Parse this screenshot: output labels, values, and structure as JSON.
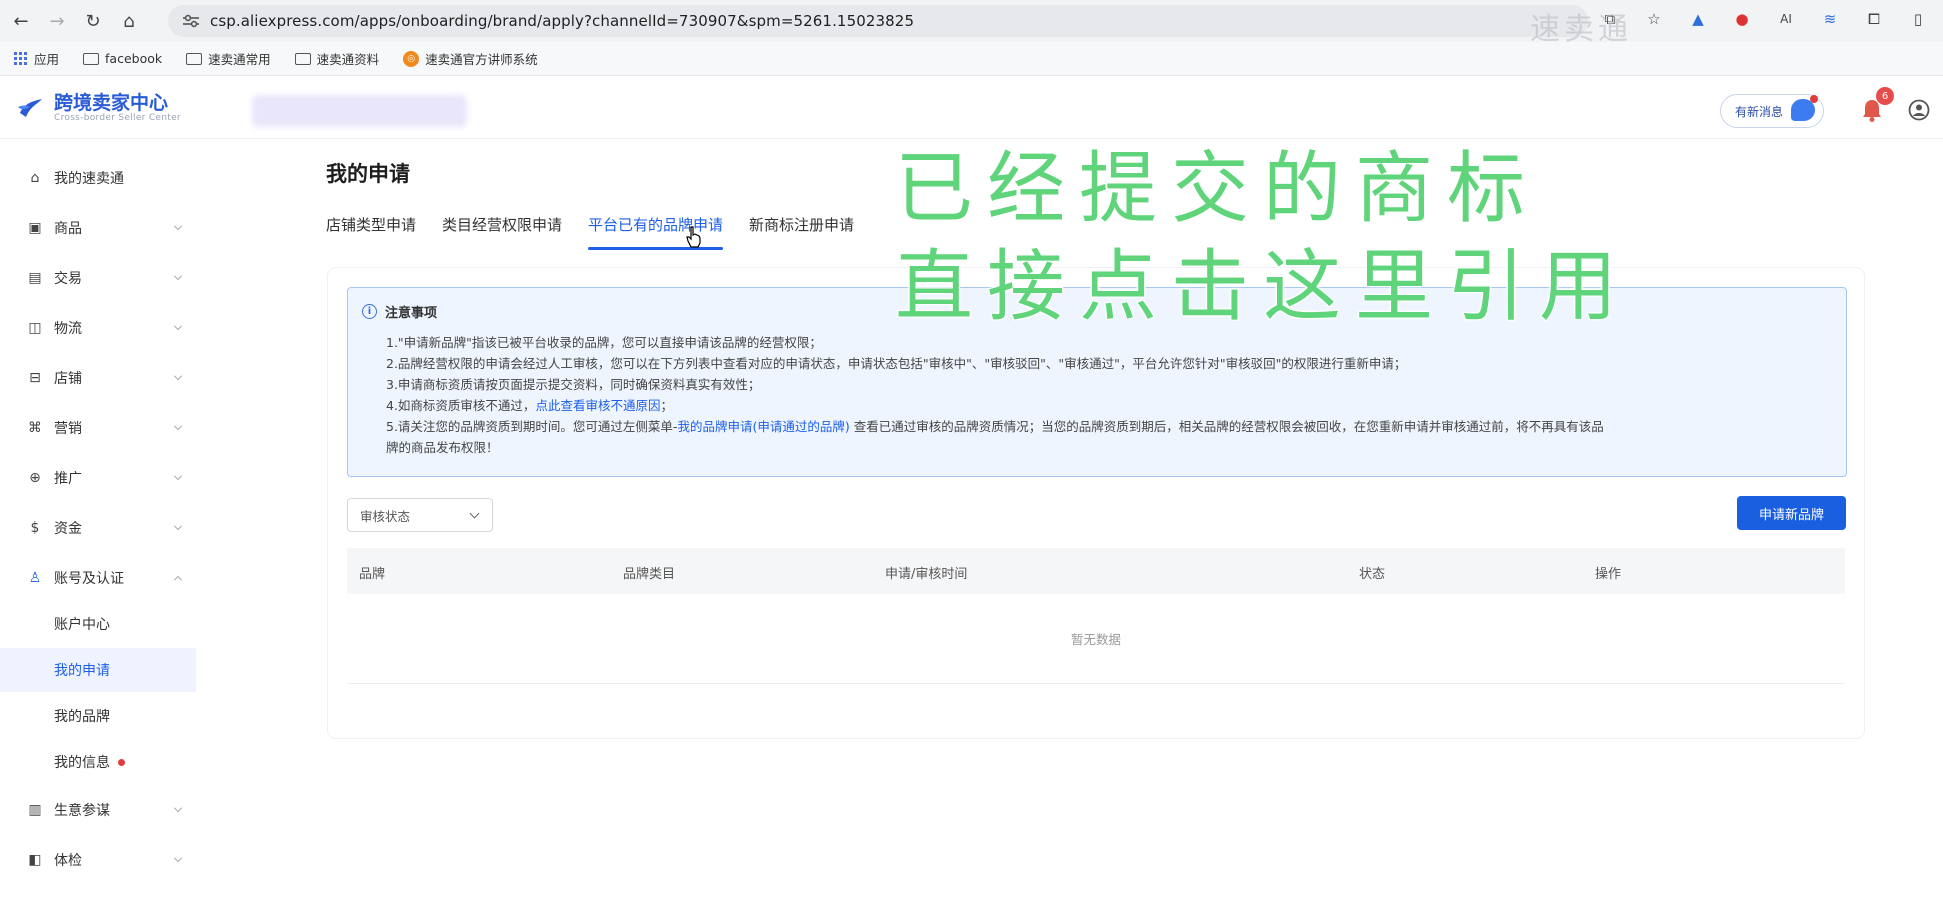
{
  "browser": {
    "url": "csp.aliexpress.com/apps/onboarding/brand/apply?channelId=730907&spm=5261.15023825",
    "watermark": "速卖通",
    "bookmarks": [
      {
        "label": "应用",
        "icon": "apps-grid-icon"
      },
      {
        "label": "facebook",
        "icon": "folder-icon"
      },
      {
        "label": "速卖通常用",
        "icon": "folder-icon"
      },
      {
        "label": "速卖通资料",
        "icon": "folder-icon"
      },
      {
        "label": "速卖通官方讲师系统",
        "icon": "orange-badge-icon"
      }
    ]
  },
  "header": {
    "logo_title": "跨境卖家中心",
    "logo_subtitle": "Cross-border Seller Center",
    "message_label": "有新消息",
    "notification_count": "6",
    "accent_color": "#1e5ee8"
  },
  "sidebar": {
    "items": [
      {
        "label": "我的速卖通",
        "icon": "home-icon",
        "expandable": false
      },
      {
        "label": "商品",
        "icon": "product-icon",
        "expandable": true
      },
      {
        "label": "交易",
        "icon": "order-icon",
        "expandable": true
      },
      {
        "label": "物流",
        "icon": "logistics-icon",
        "expandable": true
      },
      {
        "label": "店铺",
        "icon": "store-icon",
        "expandable": true
      },
      {
        "label": "营销",
        "icon": "marketing-icon",
        "expandable": true
      },
      {
        "label": "推广",
        "icon": "globe-icon",
        "expandable": true
      },
      {
        "label": "资金",
        "icon": "money-icon",
        "expandable": true
      },
      {
        "label": "账号及认证",
        "icon": "account-icon",
        "expandable": true,
        "expanded": true
      }
    ],
    "sub_items": [
      {
        "label": "账户中心",
        "active": false
      },
      {
        "label": "我的申请",
        "active": true
      },
      {
        "label": "我的品牌",
        "active": false
      },
      {
        "label": "我的信息",
        "active": false,
        "dot": true
      }
    ],
    "bottom_items": [
      {
        "label": "生意参谋",
        "icon": "analytics-icon"
      },
      {
        "label": "体检",
        "icon": "checkup-icon"
      }
    ]
  },
  "main": {
    "page_title": "我的申请",
    "tabs": [
      {
        "label": "店铺类型申请",
        "active": false
      },
      {
        "label": "类目经营权限申请",
        "active": false
      },
      {
        "label": "平台已有的品牌申请",
        "active": true
      },
      {
        "label": "新商标注册申请",
        "active": false
      }
    ],
    "notice": {
      "title": "注意事项",
      "line1": "1.\"申请新品牌\"指该已被平台收录的品牌，您可以直接申请该品牌的经营权限；",
      "line2": "2.品牌经营权限的申请会经过人工审核，您可以在下方列表中查看对应的申请状态，申请状态包括\"审核中\"、\"审核驳回\"、\"审核通过\"，平台允许您针对\"审核驳回\"的权限进行重新申请；",
      "line3": "3.申请商标资质请按页面提示提交资料，同时确保资料真实有效性；",
      "line4_pre": "4.如商标资质审核不通过，",
      "line4_link": "点此查看审核不通原因",
      "line4_post": "；",
      "line5_pre": "5.请关注您的品牌资质到期时间。您可通过左侧菜单-",
      "line5_link": "我的品牌申请(申请通过的品牌)",
      "line5_post": " 查看已通过审核的品牌资质情况；当您的品牌资质到期后，相关品牌的经营权限会被回收，在您重新申请并审核通过前，将不再具有该品",
      "line5_cont": "牌的商品发布权限！"
    },
    "filter_placeholder": "审核状态",
    "apply_button": "申请新品牌",
    "table": {
      "columns": [
        "品牌",
        "品牌类目",
        "申请/审核时间",
        "状态",
        "操作"
      ],
      "empty_text": "暂无数据"
    }
  },
  "overlay": {
    "line1": "已经提交的商标",
    "line2": "直接点击这里引用",
    "color": "#5fd47a"
  }
}
